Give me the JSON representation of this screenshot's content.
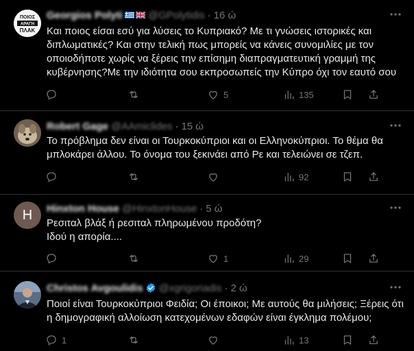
{
  "tweets": [
    {
      "avatar": "ποιος-αραγη-πλακ-logo",
      "avatar_text": "ΠΟΙΟΣ ΑΡΑΓΗ ΠΛΑΚ",
      "name": "Georgios Polyti",
      "flags": [
        "greece-flag",
        "uk-flag"
      ],
      "handle": "@GPolytidis",
      "time": "16 ώ",
      "text": "Και ποιος είσαι εσύ για λύσεις το Κυπριακό? Με τι γνώσεις ιστορικές και διπλωματικές? Και στην τελική πως μπορείς να κάνεις συνομιλίες με τον οποιοδήποτε χωρίς να ξέρεις την επίσημη διαπραγματευτική γραμμή της κυβέρνησης?Με την ιδιότητα σου εκπροσωπείς την Κύπρο όχι τον εαυτό σου",
      "replies": "",
      "reposts": "",
      "likes": "5",
      "views": "135"
    },
    {
      "avatar": "dog-photo-avatar",
      "name": "Robert Gage",
      "handle": "@AAmiclides",
      "time": "15 ώ",
      "text": "Το πρόβλημα δεν είναι οι Τουρκοκύπριοι και οι Ελληνοκύπριοι. Το θέμα θα μπλοκάρει άλλου. Το όνομα του ξεκινάει από Ρε και τελειώνει σε τζεπ.",
      "replies": "",
      "reposts": "",
      "likes": "",
      "views": "92"
    },
    {
      "avatar": "letter-h-avatar",
      "avatar_letter": "H",
      "name": "Hinxton House",
      "handle": "@HinxtonHouse",
      "time": "5 ώ",
      "text": "Ρεσιταλ βλάξ ή ρεσιταλ πληρωμένου προδότη?\nΙδού η απορία....",
      "replies": "",
      "reposts": "",
      "likes": "1",
      "views": "29"
    },
    {
      "avatar": "person-photo-avatar",
      "name": "Christos Avgoulidis",
      "verified": true,
      "handle": "@xgrigoriadis",
      "time": "2 ώ",
      "text": "Ποιοί είναι Τουρκοκύπριοι Φειδία; Οι έποικοι; Με αυτούς θα μιλήσεις; Ξέρεις ότι η δημογραφική αλλοίωση κατεχομένων εδαφών είναι έγκλημα πολέμου;",
      "replies": "1",
      "reposts": "",
      "likes": "",
      "views": "13"
    }
  ],
  "colors": {
    "background": "#000000",
    "text": "#e7e9ea",
    "muted": "#71767b",
    "border": "#2f3336",
    "verified": "#1d9bf0"
  },
  "icons": {
    "reply": "reply-icon",
    "repost": "repost-icon",
    "like": "like-icon",
    "views": "views-icon",
    "bookmark": "bookmark-icon",
    "share": "share-icon",
    "more": "more-icon"
  }
}
